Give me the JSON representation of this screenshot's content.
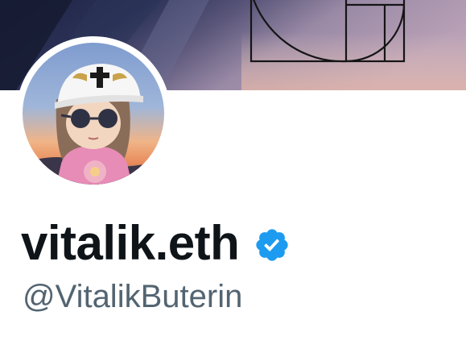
{
  "profile": {
    "display_name": "vitalik.eth",
    "handle": "@VitalikButerin",
    "verified": true
  },
  "banner": {
    "description_icon": "golden-spiral-artwork"
  },
  "avatar": {
    "description_icon": "avatar-image"
  },
  "colors": {
    "name_text": "#0f1419",
    "handle_text": "#536471",
    "verified_badge": "#1d9bf0"
  }
}
